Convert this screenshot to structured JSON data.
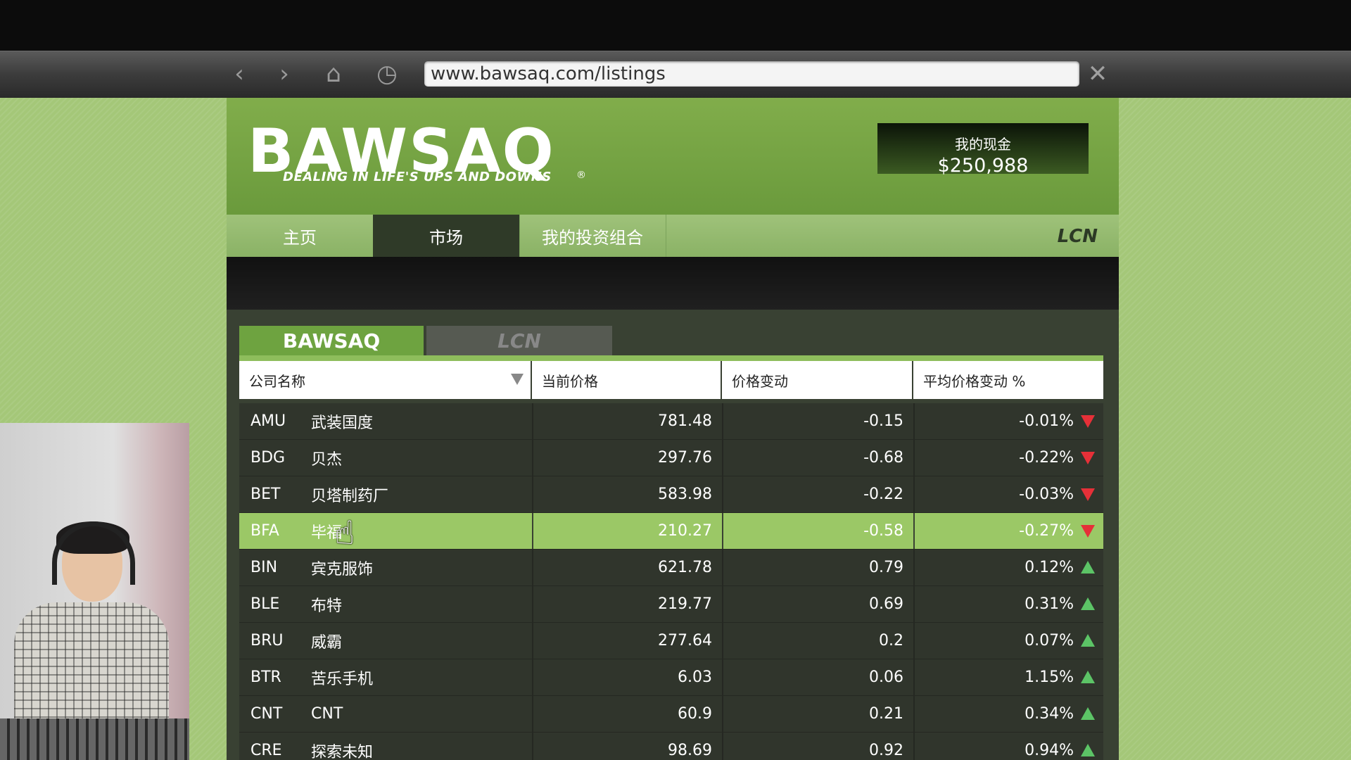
{
  "browser": {
    "url": "www.bawsaq.com/listings",
    "back_icon": "‹",
    "forward_icon": "›",
    "home_icon": "⌂",
    "history_icon": "◷",
    "close_icon": "✕"
  },
  "header": {
    "logo": "BAWSAQ",
    "logo_registered": "®",
    "tagline": "DEALING IN LIFE'S UPS AND DOWNS",
    "cash_label": "我的现金",
    "cash_value": "$250,988"
  },
  "nav": {
    "tabs": [
      {
        "label": "主页"
      },
      {
        "label": "市场"
      },
      {
        "label": "我的投资组合"
      }
    ],
    "active_tab": "市场",
    "partner_logo": "LCN"
  },
  "exchange_tabs": [
    {
      "label": "BAWSAQ"
    },
    {
      "label": "LCN"
    }
  ],
  "table": {
    "headers": [
      "公司名称",
      "当前价格",
      "价格变动",
      "平均价格变动 %"
    ],
    "rows": [
      {
        "symbol": "AMU",
        "name": "武装国度",
        "price": "781.48",
        "change": "-0.15",
        "pct": "-0.01%",
        "dir": "down"
      },
      {
        "symbol": "BDG",
        "name": "贝杰",
        "price": "297.76",
        "change": "-0.68",
        "pct": "-0.22%",
        "dir": "down"
      },
      {
        "symbol": "BET",
        "name": "贝塔制药厂",
        "price": "583.98",
        "change": "-0.22",
        "pct": "-0.03%",
        "dir": "down"
      },
      {
        "symbol": "BFA",
        "name": "毕福",
        "price": "210.27",
        "change": "-0.58",
        "pct": "-0.27%",
        "dir": "down"
      },
      {
        "symbol": "BIN",
        "name": "宾克服饰",
        "price": "621.78",
        "change": "0.79",
        "pct": "0.12%",
        "dir": "up"
      },
      {
        "symbol": "BLE",
        "name": "布特",
        "price": "219.77",
        "change": "0.69",
        "pct": "0.31%",
        "dir": "up"
      },
      {
        "symbol": "BRU",
        "name": "威霸",
        "price": "277.64",
        "change": "0.2",
        "pct": "0.07%",
        "dir": "up"
      },
      {
        "symbol": "BTR",
        "name": "苦乐手机",
        "price": "6.03",
        "change": "0.06",
        "pct": "1.15%",
        "dir": "up"
      },
      {
        "symbol": "CNT",
        "name": "CNT",
        "price": "60.9",
        "change": "0.21",
        "pct": "0.34%",
        "dir": "up"
      },
      {
        "symbol": "CRE",
        "name": "探索未知",
        "price": "98.69",
        "change": "0.92",
        "pct": "0.94%",
        "dir": "up"
      }
    ]
  },
  "colors": {
    "brand_green": "#6ea340",
    "highlight_row": "#9bc866",
    "down_arrow": "#e63038",
    "up_arrow": "#5cc466"
  }
}
